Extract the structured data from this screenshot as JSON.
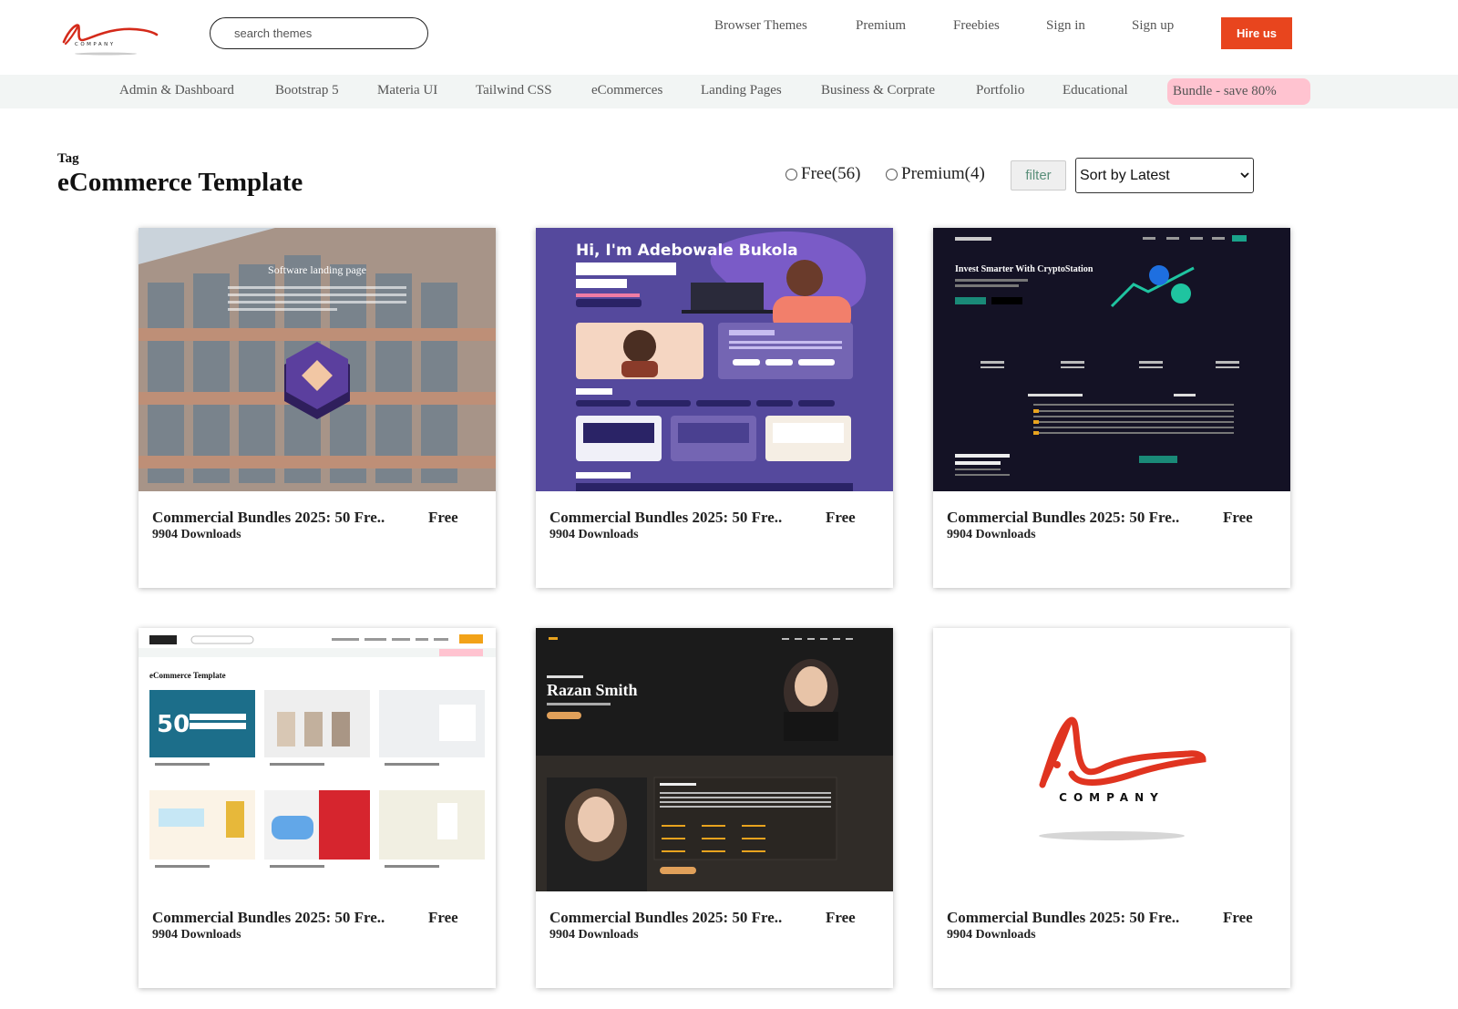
{
  "header": {
    "logo_text": "COMPANY",
    "search_placeholder": "search themes",
    "nav": [
      "Browser Themes",
      "Premium",
      "Freebies",
      "Sign in",
      "Sign up"
    ],
    "hire_label": "Hire us"
  },
  "categories": [
    "Admin & Dashboard",
    "Bootstrap 5",
    "Materia UI",
    "Tailwind CSS",
    "eCommerces",
    "Landing Pages",
    "Business & Corprate",
    "Portfolio",
    "Educational"
  ],
  "bundle_label": "Bundle - save 80%",
  "page": {
    "tag_label": "Tag",
    "title": "eCommerce Template",
    "free_option": "Free(56)",
    "premium_option": "Premium(4)",
    "filter_label": "filter",
    "sort_value": "Sort by Latest"
  },
  "cards": [
    {
      "title": "Commercial Bundles 2025: 50 Fre..",
      "price": "Free",
      "downloads": "9904 Downloads",
      "thumb_caption": "Software landing page"
    },
    {
      "title": "Commercial Bundles 2025: 50 Fre..",
      "price": "Free",
      "downloads": "9904 Downloads",
      "thumb_caption": "Hi, I'm Adebowale Bukola"
    },
    {
      "title": "Commercial Bundles 2025: 50 Fre..",
      "price": "Free",
      "downloads": "9904 Downloads",
      "thumb_caption": "Invest Smarter With CryptoStation"
    },
    {
      "title": "Commercial Bundles 2025: 50 Fre..",
      "price": "Free",
      "downloads": "9904 Downloads",
      "thumb_caption": "eCommerce Template"
    },
    {
      "title": "Commercial Bundles 2025: 50 Fre..",
      "price": "Free",
      "downloads": "9904 Downloads",
      "thumb_caption": "Razan Smith"
    },
    {
      "title": "Commercial Bundles 2025: 50 Fre..",
      "price": "Free",
      "downloads": "9904 Downloads",
      "thumb_caption": "COMPANY"
    }
  ],
  "colors": {
    "accent": "#e8451e",
    "bundle_bg": "#ffc3d0",
    "catbar_bg": "#f2f5f4"
  }
}
